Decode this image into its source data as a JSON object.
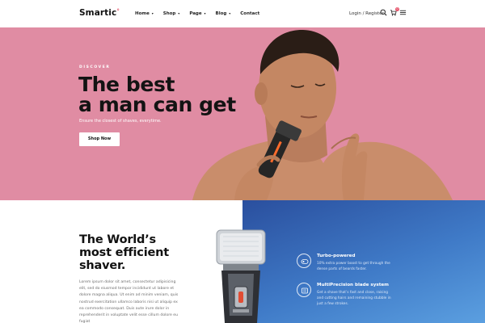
{
  "brand": {
    "name": "Smartic",
    "mark": "°"
  },
  "nav": [
    {
      "label": "Home"
    },
    {
      "label": "Shop"
    },
    {
      "label": "Page"
    },
    {
      "label": "Blog"
    },
    {
      "label": "Contact"
    }
  ],
  "header": {
    "auth_label": "Login / Register",
    "cart_count": "0"
  },
  "hero": {
    "kicker": "DISCOVER",
    "title_line1": "The best",
    "title_line2": "a man can get",
    "subtitle": "Ensure the closest of shaves, everytime.",
    "cta": "Shop Now"
  },
  "features": {
    "title_line1": "The World’s",
    "title_line2": "most efficient",
    "title_line3": "shaver.",
    "body": "Lorem ipsum dolor sit amet, consectetur adipisicing elit, sed do eiusmod tempor incididunt ut labore et dolore magna aliqua. Ut enim ad minim veniam, quis nostrud exercitation ullamco laboris nisi ut aliquip ex ea commodo consequat. Duis aute irure dolor in reprehenderit in voluptate velit esse cillum dolore eu fugiat",
    "items": [
      {
        "icon": "turbo-icon",
        "name": "Turbo-powered",
        "desc": "10% extra power boost to get through the dense parts of beards faster."
      },
      {
        "icon": "blade-icon",
        "name": "MultiPrecision blade system",
        "desc": "Get a shave that’s fast and close, raising and cutting hairs and remaining stubble in just a few strokes."
      }
    ]
  },
  "colors": {
    "accent": "#e6536a",
    "hero_bg": "#e08ca3",
    "panel_blue": "#3f7ac7"
  }
}
